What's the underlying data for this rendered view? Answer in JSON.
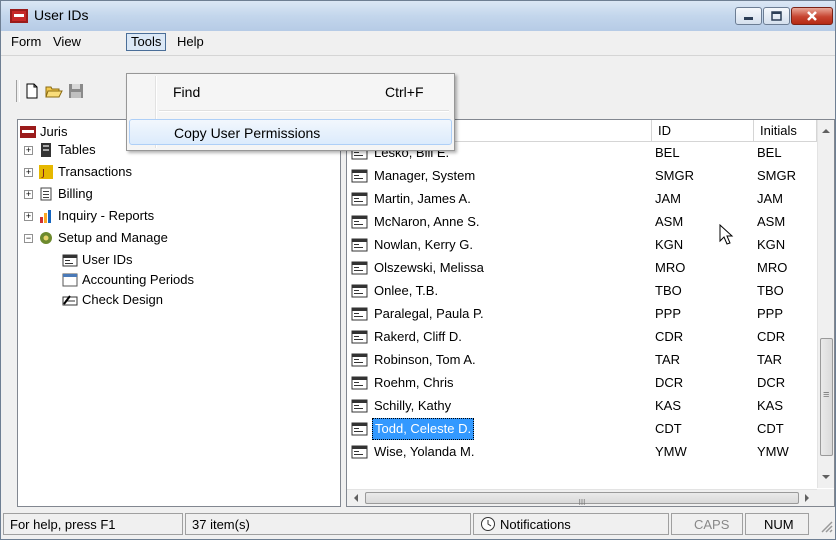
{
  "window": {
    "title": "User IDs",
    "accent": "#c3d6ec"
  },
  "menu": {
    "form": "Form",
    "view": "View",
    "tools": "Tools",
    "help": "Help"
  },
  "tools_menu": {
    "find_label": "Find",
    "find_shortcut": "Ctrl+F",
    "copy_label": "Copy User Permissions"
  },
  "toolbar": {
    "icons": [
      "new-icon",
      "open-folder-icon",
      "save-icon"
    ]
  },
  "tree": {
    "root": "Juris",
    "tables": "Tables",
    "transactions": "Transactions",
    "billing": "Billing",
    "inquiry": "Inquiry - Reports",
    "setup": "Setup and Manage",
    "user_ids": "User IDs",
    "accounting_periods": "Accounting Periods",
    "check_design": "Check Design"
  },
  "list": {
    "columns": {
      "name": "",
      "id": "ID",
      "initials": "Initials"
    },
    "rows": [
      {
        "name": "Lesko, Bill E.",
        "id": "BEL",
        "initials": "BEL"
      },
      {
        "name": "Manager, System",
        "id": "SMGR",
        "initials": "SMGR"
      },
      {
        "name": "Martin, James A.",
        "id": "JAM",
        "initials": "JAM"
      },
      {
        "name": "McNaron, Anne S.",
        "id": "ASM",
        "initials": "ASM"
      },
      {
        "name": "Nowlan, Kerry G.",
        "id": "KGN",
        "initials": "KGN"
      },
      {
        "name": "Olszewski, Melissa",
        "id": "MRO",
        "initials": "MRO"
      },
      {
        "name": "Onlee, T.B.",
        "id": "TBO",
        "initials": "TBO"
      },
      {
        "name": "Paralegal, Paula P.",
        "id": "PPP",
        "initials": "PPP"
      },
      {
        "name": "Rakerd, Cliff D.",
        "id": "CDR",
        "initials": "CDR"
      },
      {
        "name": "Robinson, Tom A.",
        "id": "TAR",
        "initials": "TAR"
      },
      {
        "name": "Roehm, Chris",
        "id": "DCR",
        "initials": "DCR"
      },
      {
        "name": "Schilly, Kathy",
        "id": "KAS",
        "initials": "KAS"
      },
      {
        "name": "Todd, Celeste D.",
        "id": "CDT",
        "initials": "CDT"
      },
      {
        "name": "Wise, Yolanda M.",
        "id": "YMW",
        "initials": "YMW"
      }
    ],
    "selected_color": "#3399ff",
    "hscroll_glyph": "III",
    "vscroll_glyph": "≡"
  },
  "status": {
    "help": "For help, press F1",
    "count": "37 item(s)",
    "notifications": "Notifications",
    "caps": "CAPS",
    "num": "NUM"
  }
}
